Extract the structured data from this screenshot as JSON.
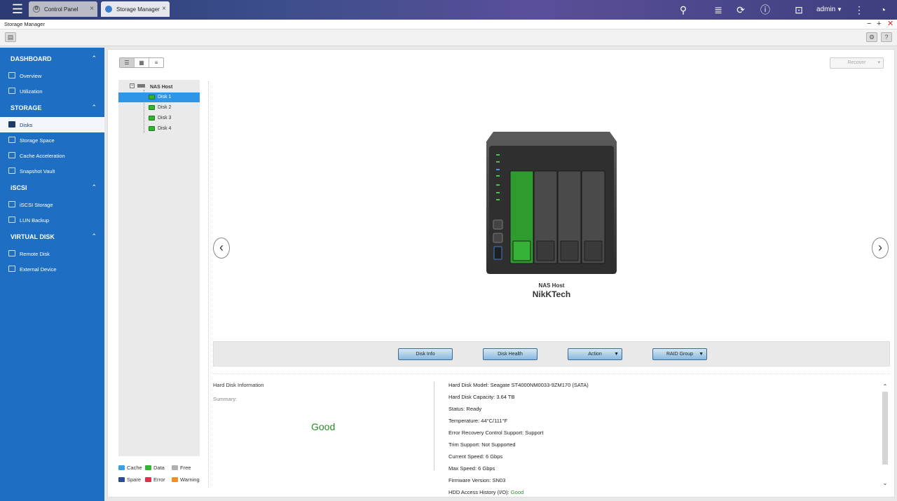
{
  "topbar": {
    "tabs": [
      {
        "label": "Control Panel"
      },
      {
        "label": "Storage Manager"
      }
    ],
    "user": "admin"
  },
  "window": {
    "title": "Storage Manager"
  },
  "sidebar": {
    "sections": [
      {
        "label": "DASHBOARD",
        "items": [
          {
            "label": "Overview"
          },
          {
            "label": "Utilization"
          }
        ]
      },
      {
        "label": "STORAGE",
        "items": [
          {
            "label": "Disks"
          },
          {
            "label": "Storage Space"
          },
          {
            "label": "Cache Acceleration"
          },
          {
            "label": "Snapshot Vault"
          }
        ]
      },
      {
        "label": "iSCSI",
        "items": [
          {
            "label": "iSCSI Storage"
          },
          {
            "label": "LUN Backup"
          }
        ]
      },
      {
        "label": "VIRTUAL DISK",
        "items": [
          {
            "label": "Remote Disk"
          },
          {
            "label": "External Device"
          }
        ]
      }
    ],
    "active": "Disks"
  },
  "main": {
    "recover_label": "Recover",
    "tree": {
      "root": "NAS Host",
      "disks": [
        "Disk 1",
        "Disk 2",
        "Disk 3",
        "Disk 4"
      ],
      "selected": "Disk 1"
    },
    "legend": [
      {
        "label": "Cache",
        "color": "#3aa0e0"
      },
      {
        "label": "Data",
        "color": "#33b533"
      },
      {
        "label": "Free",
        "color": "#b0b0b0"
      },
      {
        "label": "Spare",
        "color": "#2c4a9a"
      },
      {
        "label": "Error",
        "color": "#e0304a"
      },
      {
        "label": "Warning",
        "color": "#f09020"
      }
    ],
    "device": {
      "subtitle": "NAS Host",
      "name": "NikKTech"
    },
    "actions": [
      "Disk Info",
      "Disk Health",
      "Action",
      "RAID Group"
    ],
    "info": {
      "left_title": "Hard Disk Information",
      "summary_label": "Summary:",
      "summary_value": "Good",
      "lines": [
        "Hard Disk Model: Seagate ST4000NM0033-9ZM170 (SATA)",
        "Hard Disk Capacity: 3.64 TB",
        "Status: Ready",
        "Temperature: 44°C/111°F",
        "Error Recovery Control Support: Support",
        "Trim Support: Not Supported",
        "Current Speed: 6 Gbps",
        "Max Speed: 6 Gbps",
        "Firmware Version: SN03"
      ],
      "hdd_history_label": "HDD Access History (I/O):",
      "hdd_history_value": "Good"
    }
  }
}
